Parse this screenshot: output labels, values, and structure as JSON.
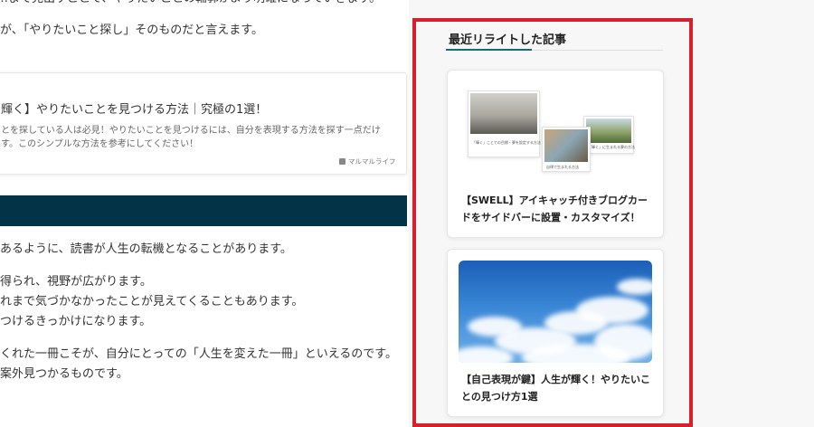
{
  "article": {
    "line0": "…まで見出すことで、やりたいことの輪郭がより明確になっていきます。",
    "line1": "が、「やりたいこと探し」そのものだと言えます。",
    "blogcard": {
      "title": "輝く】やりたいことを見つける方法｜究極の1選！",
      "excerpt1": "とを探している人は必見！やりたいことを見つけるには、自分を表現する方法を探す一点だけ",
      "excerpt2": "す。このシンプルな方法を参考にしてください！",
      "site": "マルマルライフ"
    },
    "lines": [
      "あるように、読書が人生の転機となることがあります。",
      "得られ、視野が広がります。",
      "れまで気づかなかったことが見えてくることもあります。",
      "つけるきっかけになります。",
      "くれた一冊こそが、自分にとっての「人生を変えた一冊」といえるのです。",
      "案外見つかるものです。"
    ]
  },
  "sidebar": {
    "widget_title": "最近リライトした記事",
    "cards": [
      {
        "title_line1": "【SWELL】アイキャッチ付きブログカー",
        "title_line2": "ドをサイドバーに設置・カスタマイズ！",
        "thumb_captions": [
          "「輝く」ことでの目標・夢を設定する方法",
          "自律で生まれる方法",
          "「輝く」に生まれる夢の方法"
        ]
      },
      {
        "title_line1": "【自己表現が鍵】人生が輝く！やりたいこ",
        "title_line2": "との見つけ方1選"
      }
    ]
  },
  "colors": {
    "highlight_border": "#d9202a",
    "heading_bar": "#033347",
    "accent_rule": "#0f6e7e"
  }
}
